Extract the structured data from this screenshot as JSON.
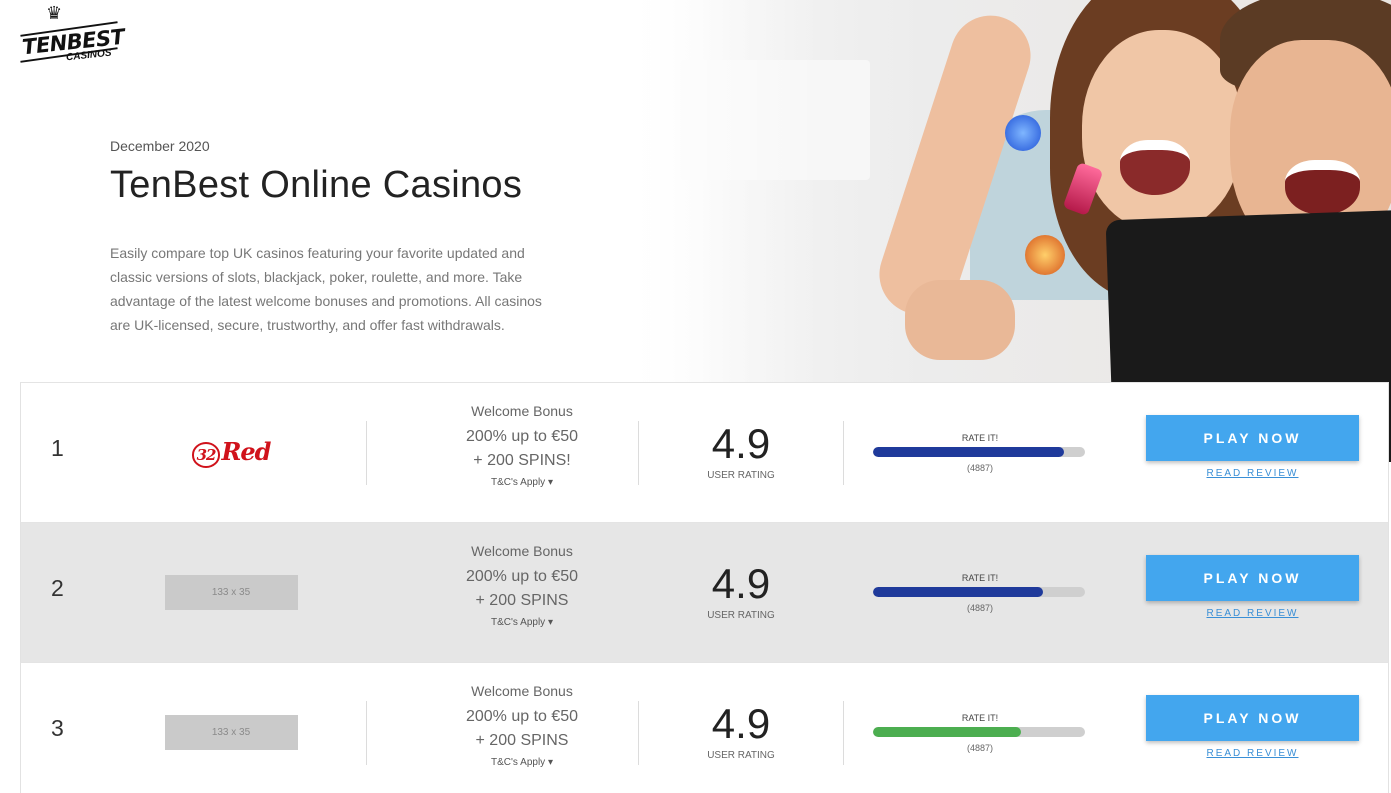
{
  "brand": {
    "name": "TENBEST",
    "subtitle": "CASINOS",
    "crown_icon": "crown-icon"
  },
  "hero": {
    "date": "December 2020",
    "title": "TenBest Online Casinos",
    "description": "Easily compare top UK casinos featuring your favorite updated and classic versions of slots, blackjack, poker, roulette, and more. Take advantage of the latest welcome bonuses and promotions. All casinos are UK-licensed, secure, trustworthy, and offer fast withdrawals."
  },
  "colors": {
    "accent": "#43a6ee",
    "rating_bar_blue": "#1f3a9b",
    "rating_bar_green": "#4cae50",
    "row_alt_bg": "#e6e6e6"
  },
  "casinos": [
    {
      "rank": "1",
      "logo_text": "Red",
      "logo_number": "32",
      "bonus_head": "Welcome Bonus",
      "bonus_line1": "200% up to €50",
      "bonus_line2": "+ 200 SPINS!",
      "tc": "T&C's Apply",
      "rating": "4.9",
      "rating_label": "USER RATING",
      "rate_label": "RATE IT!",
      "rate_fraction": 0.9,
      "rate_count": "(4887)",
      "play_label": "PLAY NOW",
      "review_label": "READ REVIEW"
    },
    {
      "rank": "2",
      "logo_placeholder": "133 x 35",
      "bonus_head": "Welcome Bonus",
      "bonus_line1": "200% up to €50",
      "bonus_line2": "+ 200 SPINS",
      "tc": "T&C's Apply",
      "rating": "4.9",
      "rating_label": "USER RATING",
      "rate_label": "RATE IT!",
      "rate_fraction": 0.8,
      "rate_count": "(4887)",
      "play_label": "PLAY NOW",
      "review_label": "READ REVIEW"
    },
    {
      "rank": "3",
      "logo_placeholder": "133 x 35",
      "bonus_head": "Welcome Bonus",
      "bonus_line1": "200% up to €50",
      "bonus_line2": "+ 200 SPINS",
      "tc": "T&C's Apply",
      "rating": "4.9",
      "rating_label": "USER RATING",
      "rate_label": "RATE IT!",
      "rate_fraction": 0.7,
      "rate_count": "(4887)",
      "play_label": "PLAY NOW",
      "review_label": "READ REVIEW"
    }
  ]
}
